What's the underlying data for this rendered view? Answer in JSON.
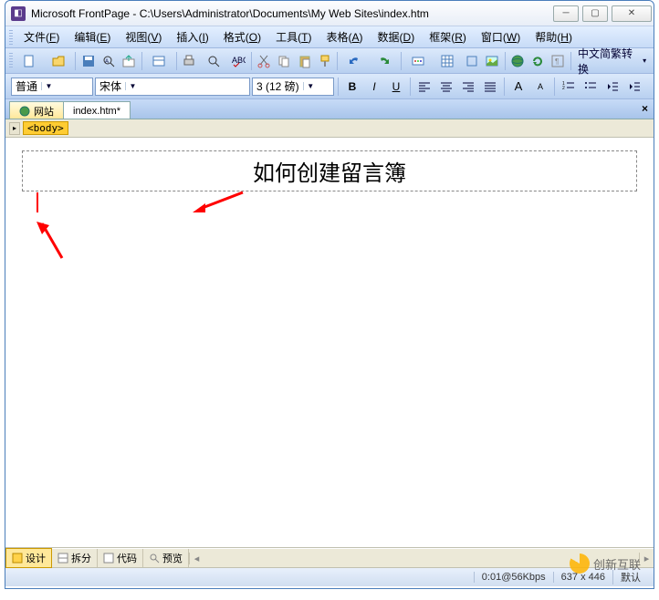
{
  "title": "Microsoft FrontPage - C:\\Users\\Administrator\\Documents\\My Web Sites\\index.htm",
  "menus": {
    "file": {
      "label": "文件",
      "accel": "F"
    },
    "edit": {
      "label": "编辑",
      "accel": "E"
    },
    "view": {
      "label": "视图",
      "accel": "V"
    },
    "insert": {
      "label": "插入",
      "accel": "I"
    },
    "format": {
      "label": "格式",
      "accel": "O"
    },
    "tools": {
      "label": "工具",
      "accel": "T"
    },
    "table": {
      "label": "表格",
      "accel": "A"
    },
    "data": {
      "label": "数据",
      "accel": "D"
    },
    "frames": {
      "label": "框架",
      "accel": "R"
    },
    "window": {
      "label": "窗口",
      "accel": "W"
    },
    "help": {
      "label": "帮助",
      "accel": "H"
    }
  },
  "toolbar": {
    "ime_label": "中文简繁转换"
  },
  "format": {
    "style": "普通",
    "font": "宋体",
    "size": "3 (12 磅)"
  },
  "tabs": {
    "site": "网站",
    "file": "index.htm*"
  },
  "crumb": {
    "body_tag": "<body>"
  },
  "page": {
    "heading": "如何创建留言簿"
  },
  "views": {
    "design": "设计",
    "split": "拆分",
    "code": "代码",
    "preview": "预览"
  },
  "status": {
    "speed": "0:01@56Kbps",
    "size": "637 x 446",
    "mode": "默认"
  },
  "watermark": "创新互联"
}
